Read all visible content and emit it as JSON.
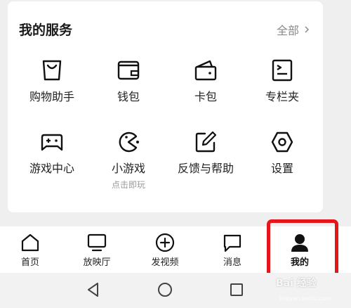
{
  "services": {
    "title": "我的服务",
    "all_label": "全部",
    "items": [
      {
        "label": "购物助手",
        "icon": "shopping-bag-icon"
      },
      {
        "label": "钱包",
        "icon": "wallet-icon"
      },
      {
        "label": "卡包",
        "icon": "card-holder-icon"
      },
      {
        "label": "专栏夹",
        "icon": "column-folder-icon"
      },
      {
        "label": "游戏中心",
        "icon": "gamepad-icon"
      },
      {
        "label": "小游戏",
        "sublabel": "点击即玩",
        "icon": "pacman-icon"
      },
      {
        "label": "反馈与帮助",
        "icon": "feedback-edit-icon"
      },
      {
        "label": "设置",
        "icon": "settings-hexagon-icon"
      }
    ]
  },
  "tabbar": {
    "items": [
      {
        "label": "首页",
        "icon": "home-icon"
      },
      {
        "label": "放映厅",
        "icon": "tv-icon"
      },
      {
        "label": "发视频",
        "icon": "plus-circle-icon"
      },
      {
        "label": "消息",
        "icon": "message-icon"
      },
      {
        "label": "我的",
        "icon": "person-icon",
        "active": true
      }
    ]
  },
  "system_nav": {
    "buttons": [
      "back-triangle-icon",
      "home-circle-icon",
      "recents-square-icon"
    ]
  },
  "watermark": {
    "text": "Bai 经验",
    "sub": "jingyan.baidu.com"
  },
  "colors": {
    "highlight": "#e8141b",
    "background": "#efefef",
    "muted": "#8a8a8a"
  }
}
